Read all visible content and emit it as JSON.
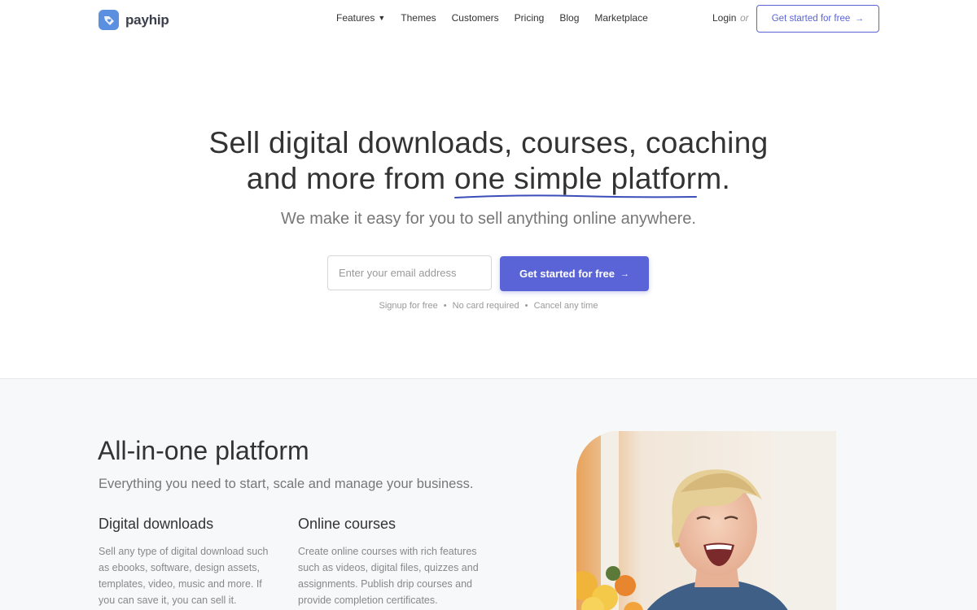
{
  "brand": {
    "name": "payhip",
    "icon": "tag-heart-icon",
    "accent": "#5a64d6"
  },
  "nav": {
    "items": [
      {
        "label": "Features",
        "has_dropdown": true
      },
      {
        "label": "Themes"
      },
      {
        "label": "Customers"
      },
      {
        "label": "Pricing"
      },
      {
        "label": "Blog"
      },
      {
        "label": "Marketplace"
      }
    ],
    "login": "Login",
    "or": "or",
    "cta": "Get started for free",
    "cta_arrow": "→"
  },
  "hero": {
    "title_line1": "Sell digital downloads, courses, coaching",
    "title_line2_prefix": "and more from ",
    "title_line2_underlined": "one simple platform",
    "title_line2_suffix": ".",
    "subtitle": "We make it easy for you to sell anything online anywhere.",
    "email_placeholder": "Enter your email address",
    "cta": "Get started for free",
    "cta_arrow": "→",
    "fine_print": [
      "Signup for free",
      "No card required",
      "Cancel any time"
    ],
    "separator": "•"
  },
  "platform": {
    "title": "All-in-one platform",
    "subtitle": "Everything you need to start, scale and manage your business.",
    "features": [
      {
        "title": "Digital downloads",
        "text": "Sell any type of digital download such as ebooks, software, design assets, templates, video, music and more. If you can save it, you can sell it."
      },
      {
        "title": "Online courses",
        "text": "Create online courses with rich features such as videos, digital files, quizzes and assignments. Publish drip courses and provide completion certificates."
      }
    ]
  }
}
